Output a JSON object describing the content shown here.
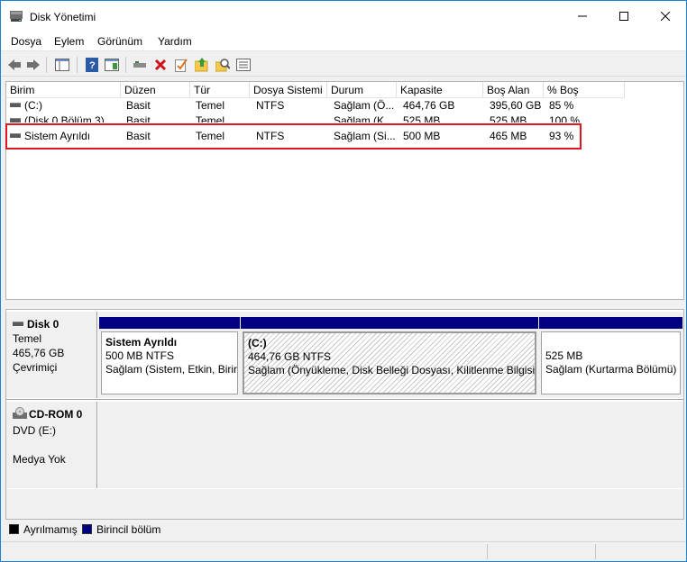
{
  "window": {
    "title": "Disk Yönetimi"
  },
  "menu": [
    "Dosya",
    "Eylem",
    "Görünüm",
    "Yardım"
  ],
  "toolbar": {
    "icons": [
      "back-icon",
      "forward-icon",
      "console-tree-icon",
      "help-icon",
      "properties-icon",
      "connect-icon",
      "delete-icon",
      "check-icon",
      "import-icon",
      "search-icon",
      "settings-icon"
    ]
  },
  "table": {
    "columns": [
      "Birim",
      "Düzen",
      "Tür",
      "Dosya Sistemi",
      "Durum",
      "Kapasite",
      "Boş Alan",
      "% Boş"
    ],
    "rows": [
      [
        "(C:)",
        "Basit",
        "Temel",
        "NTFS",
        "Sağlam (Ö...",
        "464,76 GB",
        "395,60 GB",
        "85 %"
      ],
      [
        "(Disk 0 Bölüm 3)",
        "Basit",
        "Temel",
        "",
        "Sağlam (K...",
        "525 MB",
        "525 MB",
        "100 %"
      ],
      [
        "Sistem Ayrıldı",
        "Basit",
        "Temel",
        "NTFS",
        "Sağlam (Si...",
        "500 MB",
        "465 MB",
        "93 %"
      ]
    ]
  },
  "disks": [
    {
      "name": "Disk 0",
      "type": "Temel",
      "size": "465,76 GB",
      "state": "Çevrimiçi",
      "partitions": [
        {
          "title": "Sistem Ayrıldı",
          "size": "500 MB NTFS",
          "status": "Sağlam (Sistem, Etkin, Birir"
        },
        {
          "title": "(C:)",
          "size": "464,76 GB NTFS",
          "status": "Sağlam (Önyükleme, Disk Belleği Dosyası, Kilitlenme Bilgisi,"
        },
        {
          "title": "",
          "size": "525 MB",
          "status": "Sağlam (Kurtarma Bölümü)"
        }
      ]
    },
    {
      "name": "CD-ROM 0",
      "type": "DVD (E:)",
      "size": "",
      "state": "Medya Yok"
    }
  ],
  "legend": [
    {
      "label": "Ayrılmamış",
      "color": "#000000"
    },
    {
      "label": "Birincil bölüm",
      "color": "#000080"
    }
  ],
  "colors": {
    "highlight": "#e0171e",
    "partition_bar": "#000080"
  }
}
